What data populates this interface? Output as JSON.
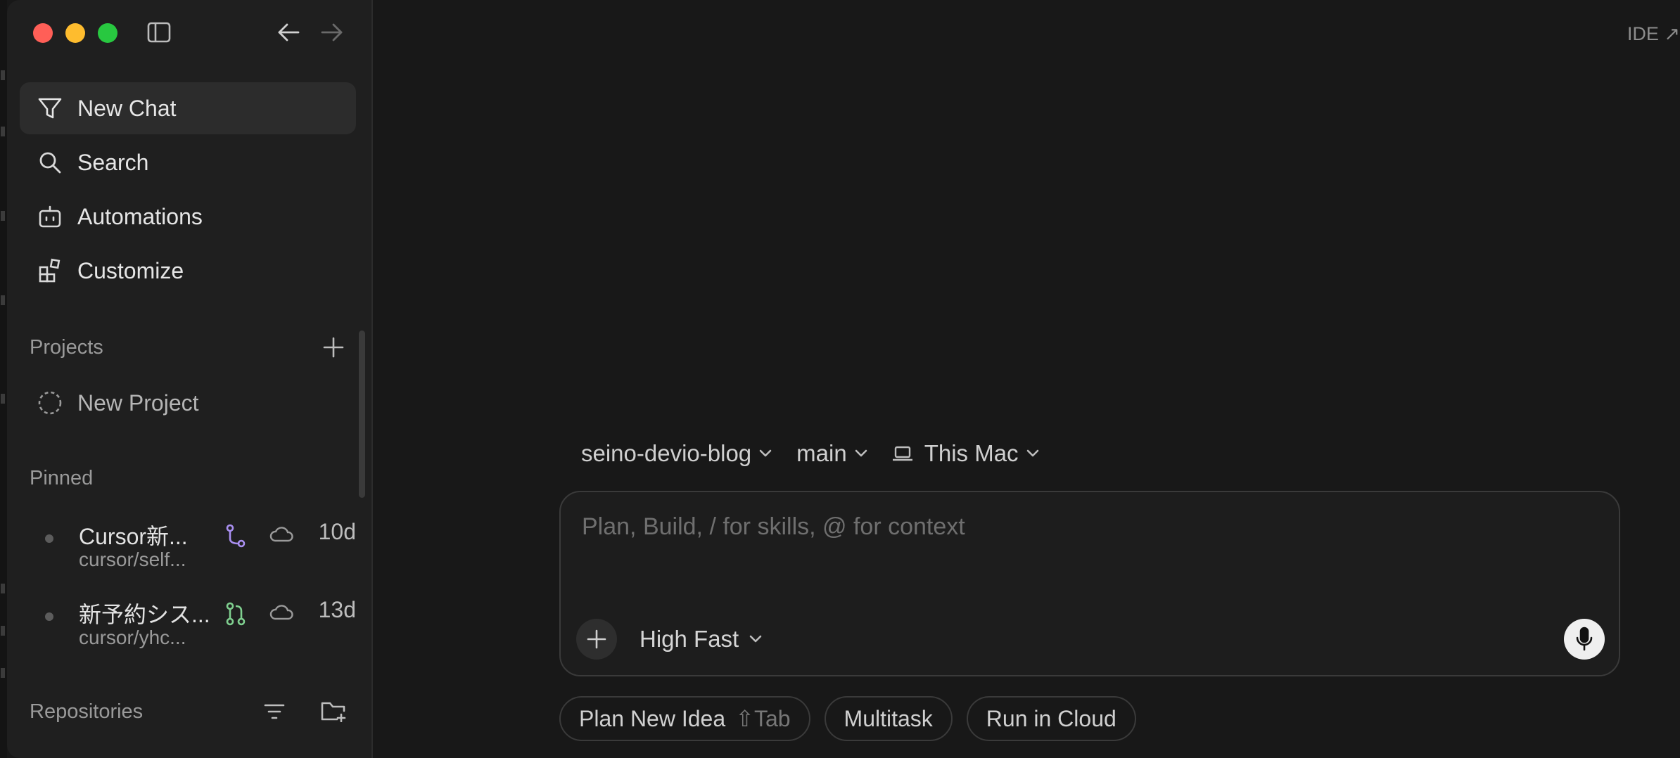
{
  "sidebar": {
    "nav": [
      {
        "label": "New Chat",
        "icon": "new-chat-icon"
      },
      {
        "label": "Search",
        "icon": "search-icon"
      },
      {
        "label": "Automations",
        "icon": "robot-icon"
      },
      {
        "label": "Customize",
        "icon": "blocks-icon"
      }
    ],
    "projects": {
      "label": "Projects",
      "new_project": "New Project"
    },
    "pinned": {
      "label": "Pinned",
      "items": [
        {
          "title": "Cursor新...",
          "branch": "cursor/self...",
          "age": "10d",
          "branch_color": "#a98ff0"
        },
        {
          "title": "新予約シス...",
          "branch": "cursor/yhc...",
          "age": "13d",
          "branch_color": "#7fcf8f"
        }
      ]
    },
    "repositories": {
      "label": "Repositories"
    }
  },
  "header": {
    "ide_link": "IDE ↗"
  },
  "context": {
    "repo": "seino-devio-blog",
    "branch": "main",
    "machine": "This Mac"
  },
  "composer": {
    "placeholder": "Plan, Build, / for skills, @ for context",
    "model": "High Fast"
  },
  "actions": [
    {
      "label": "Plan New Idea",
      "shortcut": "⇧Tab"
    },
    {
      "label": "Multitask"
    },
    {
      "label": "Run in Cloud"
    }
  ],
  "colors": {
    "background": "#181818",
    "sidebar": "#1f1f1f",
    "accent_purple": "#a98ff0",
    "accent_green": "#7fcf8f"
  }
}
